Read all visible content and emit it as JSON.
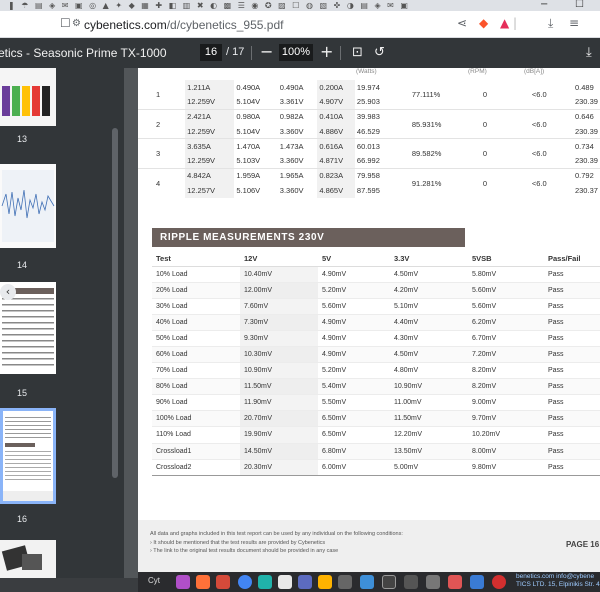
{
  "browser": {
    "tab_icons": "❚ ☂ ▤ ◈ ✉ ▣ ◎ ▲ ✦ ◆ ▦ ✚ ◧ ▥ ✖ ◐ ▩ ☰ ◉ ✪ ▨ ☐ ◍ ▧ ✜ ◑ ▤ ◈ ✉ ▣",
    "url_host": "cybenetics.com",
    "url_path": "/d/cybenetics_955.pdf",
    "window_minimize": "−",
    "window_maximize": "☐"
  },
  "pdf_toolbar": {
    "title": "etics - Seasonic Prime TX-1000",
    "current_page": "16",
    "total_pages": "/  17",
    "zoom": "100%"
  },
  "thumbnails": [
    {
      "label": "13"
    },
    {
      "label": "14"
    },
    {
      "label": "15"
    },
    {
      "label": "16"
    }
  ],
  "top_table": {
    "header_fragments": [
      "(Watts)",
      "(RPM)",
      "(dB[A])"
    ],
    "groups": [
      {
        "test": "1",
        "rows": [
          [
            "1.211A",
            "0.490A",
            "0.490A",
            "0.200A",
            "19.974"
          ],
          [
            "12.259V",
            "5.104V",
            "3.361V",
            "4.907V",
            "25.903"
          ]
        ],
        "efficiency": "77.111%",
        "fan": "0",
        "noise": "<6.0",
        "pf": [
          "0.489",
          "230.39"
        ]
      },
      {
        "test": "2",
        "rows": [
          [
            "2.421A",
            "0.980A",
            "0.982A",
            "0.410A",
            "39.983"
          ],
          [
            "12.259V",
            "5.104V",
            "3.360V",
            "4.886V",
            "46.529"
          ]
        ],
        "efficiency": "85.931%",
        "fan": "0",
        "noise": "<6.0",
        "pf": [
          "0.646",
          "230.39"
        ]
      },
      {
        "test": "3",
        "rows": [
          [
            "3.635A",
            "1.470A",
            "1.473A",
            "0.616A",
            "60.013"
          ],
          [
            "12.259V",
            "5.103V",
            "3.360V",
            "4.871V",
            "66.992"
          ]
        ],
        "efficiency": "89.582%",
        "fan": "0",
        "noise": "<6.0",
        "pf": [
          "0.734",
          "230.39"
        ]
      },
      {
        "test": "4",
        "rows": [
          [
            "4.842A",
            "1.959A",
            "1.965A",
            "0.823A",
            "79.958"
          ],
          [
            "12.257V",
            "5.106V",
            "3.360V",
            "4.865V",
            "87.595"
          ]
        ],
        "efficiency": "91.281%",
        "fan": "0",
        "noise": "<6.0",
        "pf": [
          "0.792",
          "230.37"
        ]
      }
    ]
  },
  "ripple": {
    "title": "RIPPLE MEASUREMENTS 230V",
    "headers": [
      "Test",
      "12V",
      "5V",
      "3.3V",
      "5VSB",
      "Pass/Fail"
    ],
    "rows": [
      [
        "10% Load",
        "10.40mV",
        "4.90mV",
        "4.50mV",
        "5.80mV",
        "Pass"
      ],
      [
        "20% Load",
        "12.00mV",
        "5.20mV",
        "4.20mV",
        "5.60mV",
        "Pass"
      ],
      [
        "30% Load",
        "7.60mV",
        "5.60mV",
        "5.10mV",
        "5.60mV",
        "Pass"
      ],
      [
        "40% Load",
        "7.30mV",
        "4.90mV",
        "4.40mV",
        "6.20mV",
        "Pass"
      ],
      [
        "50% Load",
        "9.30mV",
        "4.90mV",
        "4.30mV",
        "6.70mV",
        "Pass"
      ],
      [
        "60% Load",
        "10.30mV",
        "4.90mV",
        "4.50mV",
        "7.20mV",
        "Pass"
      ],
      [
        "70% Load",
        "10.90mV",
        "5.20mV",
        "4.80mV",
        "8.20mV",
        "Pass"
      ],
      [
        "80% Load",
        "11.50mV",
        "5.40mV",
        "10.90mV",
        "8.20mV",
        "Pass"
      ],
      [
        "90% Load",
        "11.90mV",
        "5.50mV",
        "11.00mV",
        "9.00mV",
        "Pass"
      ],
      [
        "100% Load",
        "20.70mV",
        "6.50mV",
        "11.50mV",
        "9.70mV",
        "Pass"
      ],
      [
        "110% Load",
        "19.90mV",
        "6.50mV",
        "12.20mV",
        "10.20mV",
        "Pass"
      ],
      [
        "Crossload1",
        "14.50mV",
        "6.80mV",
        "13.50mV",
        "8.00mV",
        "Pass"
      ],
      [
        "Crossload2",
        "20.30mV",
        "6.00mV",
        "5.00mV",
        "9.80mV",
        "Pass"
      ]
    ]
  },
  "footer": {
    "line1": "All data and graphs included in this test report can be used by any individual on the following conditions:",
    "line2": "› It should be mentioned that the test results are provided by Cybenetics",
    "line3": "› The link to the original test results document should be provided in any case",
    "page_label": "PAGE 16"
  },
  "dock": {
    "left_text": "Cyt",
    "info_line1": "benetics.com  info@cybene",
    "info_line2": "TICS LTD. 15, Elpinikis Str. 4"
  }
}
